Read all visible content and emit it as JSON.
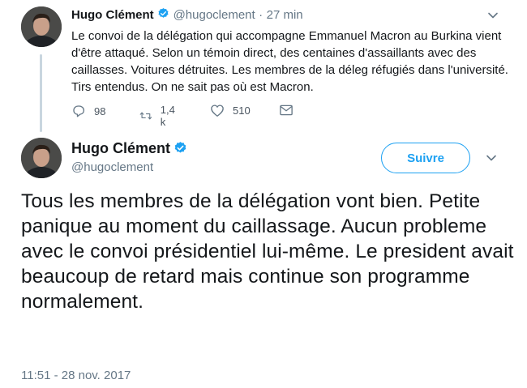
{
  "reply_tweet": {
    "author_name": "Hugo Clément",
    "handle": "@hugoclement",
    "separator": "·",
    "time_ago": "27 min",
    "text": "Le convoi de la délégation qui accompagne Emmanuel Macron au Burkina vient d'être attaqué. Selon un témoin direct, des centaines d'assaillants avec des caillasses. Voitures détruites. Les membres de la déleg réfugiés dans l'université. Tirs entendus. On ne sait pas où est Macron.",
    "replies_count": "98",
    "retweets_count": "1,4 k",
    "likes_count": "510"
  },
  "main_tweet": {
    "author_name": "Hugo Clément",
    "handle": "@hugoclement",
    "follow_label": "Suivre",
    "text": "Tous les membres de la délégation vont bien. Petite panique au moment du caillassage. Aucun probleme avec le convoi présidentiel lui-même. Le president avait beaucoup de retard mais continue son programme normalement.",
    "timestamp": "11:51 - 28 nov. 2017"
  },
  "colors": {
    "accent": "#1da1f2",
    "muted": "#657786",
    "text": "#14171a",
    "thread_line": "#c9d6df"
  },
  "icons": [
    "avatar",
    "verified-badge-icon",
    "chevron-down-icon",
    "reply-icon",
    "retweet-icon",
    "like-icon",
    "message-icon"
  ]
}
